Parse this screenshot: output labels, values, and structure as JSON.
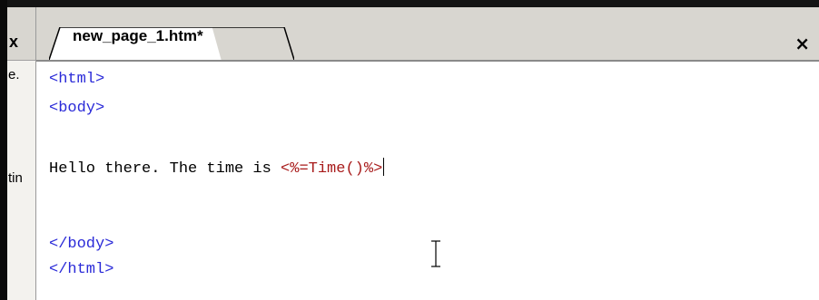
{
  "side_panel": {
    "fragments": [
      "e.",
      "tin"
    ],
    "close_icon": "close-icon"
  },
  "tabs": [
    {
      "label": "new_page_1.htm*",
      "active": true
    }
  ],
  "tabbar": {
    "close_glyph": "×",
    "close_icon": "close-icon"
  },
  "editor": {
    "lines": [
      {
        "text": "<html>",
        "kind": "tag"
      },
      {
        "text": "<body>",
        "kind": "tag"
      },
      {
        "text": "",
        "kind": "blank"
      },
      {
        "text_plain": "Hello there. The time is ",
        "text_asp": "<%=Time()%>",
        "kind": "mixed"
      },
      {
        "text": "",
        "kind": "blank"
      },
      {
        "text": "",
        "kind": "blank"
      },
      {
        "text": "</body>",
        "kind": "tag"
      },
      {
        "text": "</html>",
        "kind": "tag"
      }
    ]
  },
  "colors": {
    "tag": "#2a2ad8",
    "asp": "#a81b1b",
    "text": "#000000",
    "tabbar_bg": "#d8d6d0"
  },
  "cursor_icon": "text-ibeam-cursor-icon"
}
